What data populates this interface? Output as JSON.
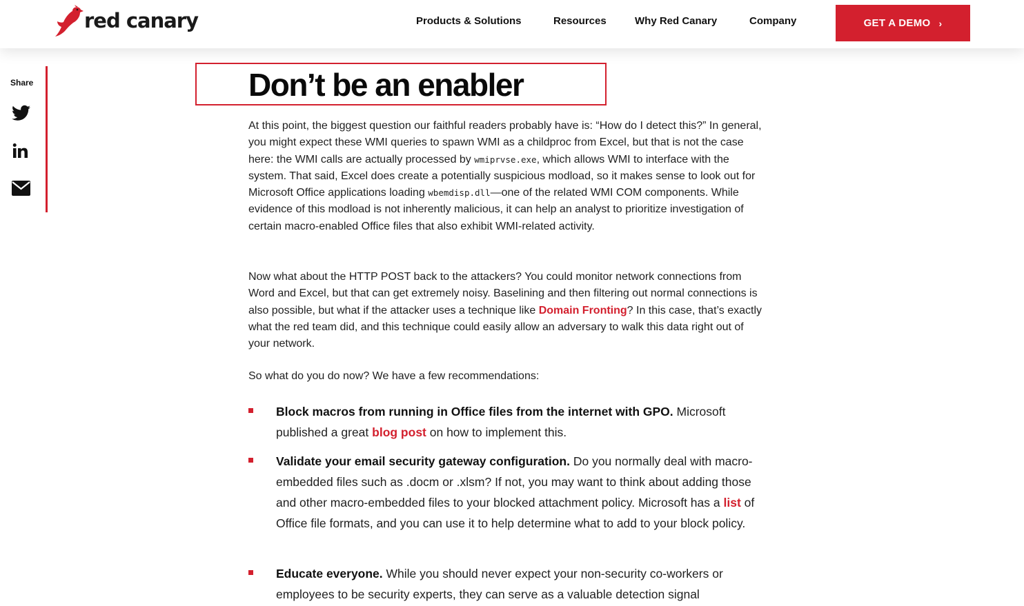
{
  "header": {
    "brand": "red canary",
    "nav": [
      {
        "label": "Products & Solutions"
      },
      {
        "label": "Resources"
      },
      {
        "label": "Why Red Canary"
      },
      {
        "label": "Company"
      }
    ],
    "cta_label": "GET A DEMO",
    "cta_chevron": "›"
  },
  "share": {
    "label": "Share",
    "icons": [
      "twitter-icon",
      "linkedin-icon",
      "email-icon"
    ]
  },
  "article": {
    "title": "Don’t be an enabler",
    "p1": {
      "a": "At this point, the biggest question our faithful readers probably have is: “How do I detect this?” In general, you might expect these WMI queries to spawn WMI as a childproc from Excel, but that is not the case here: the WMI calls are actually processed by ",
      "code1": "wmiprvse.exe",
      "b": ", which allows WMI to interface with the system. That said, Excel does create a potentially suspicious modload, so it makes sense to look out for Microsoft Office applications loading ",
      "code2": "wbemdisp.dll",
      "c": "—one of the related WMI COM components. While evidence of this modload is not inherently malicious, it can help an analyst to prioritize investigation of certain macro-enabled Office files that also exhibit WMI-related activity."
    },
    "p2": {
      "a": "Now what about the HTTP POST back to the attackers? You could monitor network connections from Word and Excel, but that can get extremely noisy. Baselining and then filtering out normal connections is also possible, but what if the attacker uses a technique like ",
      "link": "Domain Fronting",
      "b": "? In this case, that’s exactly what the red team did, and this technique could easily allow an adversary to walk this data right out of your network."
    },
    "p3": "So what do you do now? We have a few recommendations:",
    "list": [
      {
        "bold": "Block macros from running in Office files from the internet with GPO.",
        "a": " Microsoft published a great ",
        "link": "blog post",
        "b": " on how to implement this."
      },
      {
        "bold": "Validate your email security gateway configuration.",
        "a": " Do you normally deal with macro-embedded files such as .docm or .xlsm? If not, you may want to think about adding those and other macro-embedded files to your blocked attachment policy. Microsoft has a ",
        "link": "list",
        "b": " of Office file formats, and you can use it to help determine what to add to your block policy."
      },
      {
        "bold": "Educate everyone.",
        "a": " While you should never expect your non-security co-workers or employees to be security experts, they can serve as a valuable detection signal"
      }
    ]
  },
  "colors": {
    "accent": "#d3202e",
    "text": "#1f1f1f"
  }
}
